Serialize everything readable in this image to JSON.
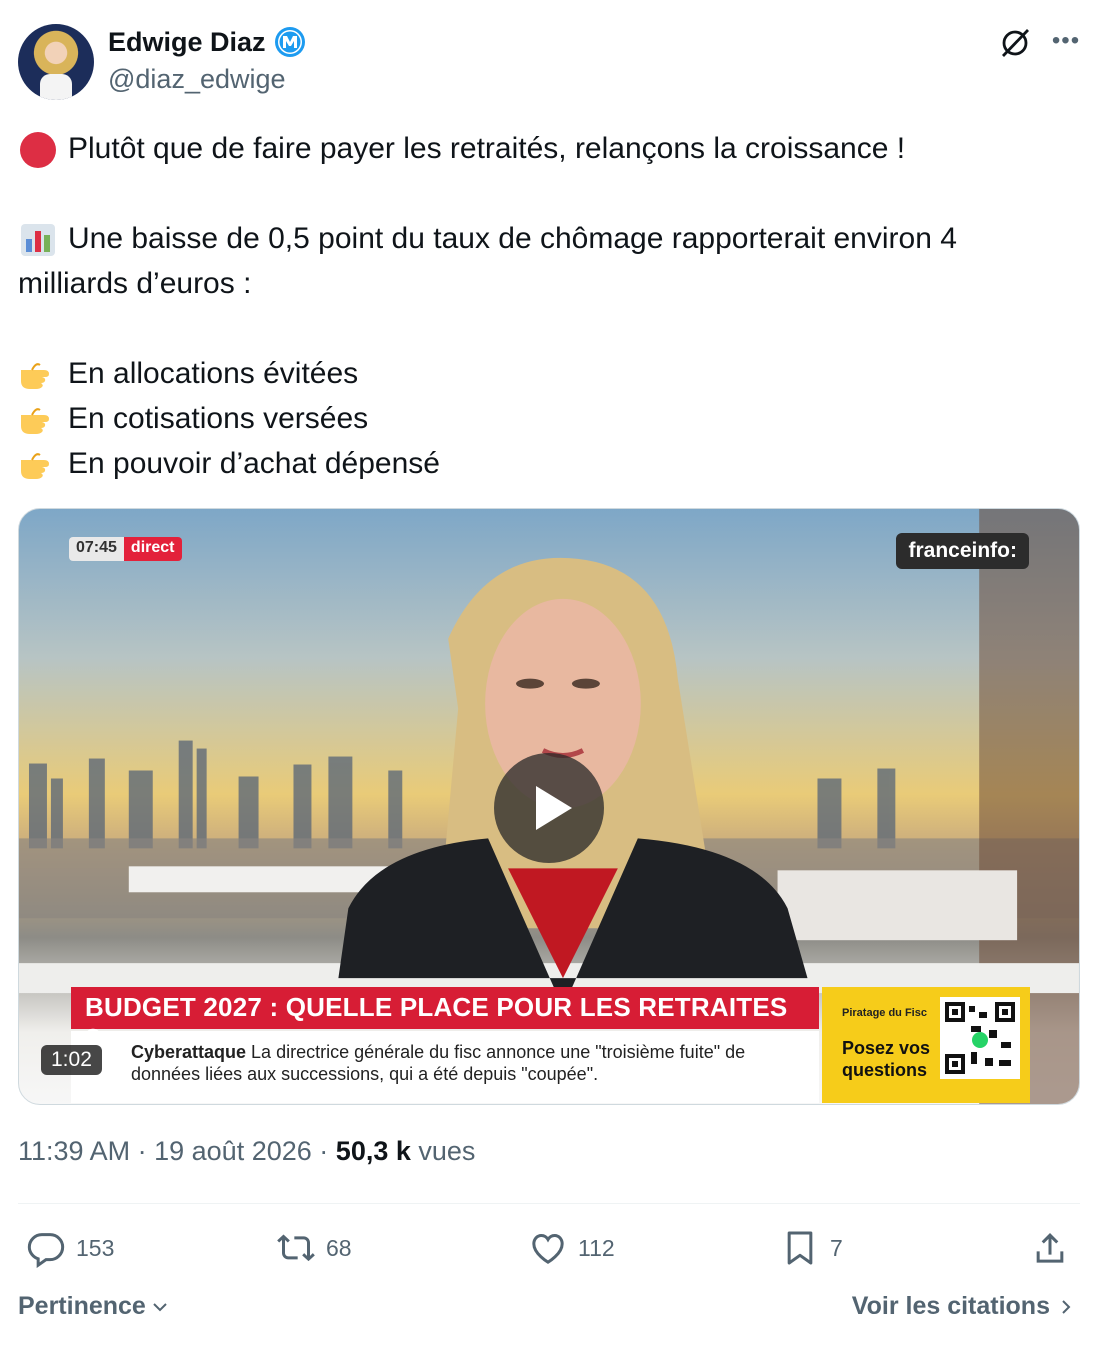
{
  "author": {
    "name": "Edwige Diaz",
    "handle": "@diaz_edwige",
    "badge_icon": "affiliate-badge-m",
    "badge_color": "#1d9bf0"
  },
  "tweet": {
    "lines": [
      {
        "emoji": "red-circle-icon",
        "text": "Plutôt que de faire payer les retraités, relançons la croissance !"
      },
      {
        "emoji": "bar-chart-icon",
        "text": "Une baisse de 0,5 point du taux de chômage rapporterait environ 4",
        "continuation": "milliards d’euros :"
      },
      {
        "emoji": "pointing-hand-icon",
        "text": "En allocations évitées"
      },
      {
        "emoji": "pointing-hand-icon",
        "text": "En cotisations versées"
      },
      {
        "emoji": "pointing-hand-icon",
        "text": "En pouvoir d’achat dépensé"
      }
    ]
  },
  "video": {
    "duration": "1:02",
    "broadcast_time": "07:45",
    "live_label": "direct",
    "channel_logo": "franceinfo:",
    "headline": "BUDGET 2027 : QUELLE PLACE POUR LES RETRAITES ?",
    "ticker_bold": "Cyberattaque",
    "ticker_text": "La directrice générale du fisc annonce une \"troisième fuite\" de données liées aux successions, qui a été depuis \"coupée\".",
    "side_small": "Piratage du Fisc",
    "side_big_1": "Posez vos",
    "side_big_2": "questions"
  },
  "meta": {
    "time": "11:39 AM",
    "separator": "·",
    "date": "19 août 2026",
    "views_count": "50,3 k",
    "views_label": "vues"
  },
  "actions": {
    "replies": "153",
    "reposts": "68",
    "likes": "112",
    "bookmarks": "7"
  },
  "footer": {
    "sort_label": "Pertinence",
    "quotes_label": "Voir les citations"
  },
  "colors": {
    "text_primary": "#0f1419",
    "text_secondary": "#536471",
    "accent_red": "#d71d35",
    "banner_yellow": "#f6cc1a"
  }
}
